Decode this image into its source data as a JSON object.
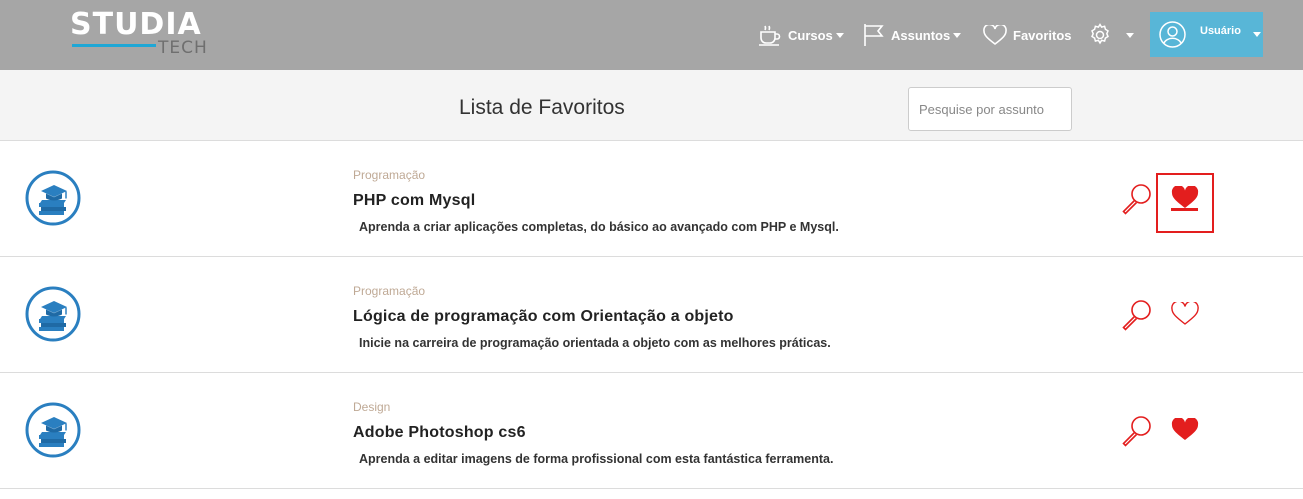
{
  "brand": {
    "main": "STUDIA",
    "sub": "TECH",
    "accent_color": "#1ea7d6"
  },
  "nav": {
    "cursos": {
      "label": "Cursos",
      "icon": "coffee-cup-icon"
    },
    "assuntos": {
      "label": "Assuntos",
      "icon": "flag-icon"
    },
    "favoritos": {
      "label": "Favoritos",
      "icon": "heart-outline-icon"
    },
    "settings": {
      "icon": "gear-icon"
    },
    "user": {
      "label": "Usuário",
      "icon": "user-avatar-icon",
      "bg_color": "#58b6d7"
    }
  },
  "header": {
    "title": "Lista de Favoritos",
    "search_placeholder": "Pesquise por assunto"
  },
  "courses": [
    {
      "category": "Programação",
      "title": "PHP com Mysql",
      "description": "Aprenda a criar aplicações completas, do básico ao avançado com PHP e Mysql.",
      "icon": "graduation-books-icon",
      "favorited": true,
      "highlighted": true
    },
    {
      "category": "Programação",
      "title": "Lógica de programação com Orientação a objeto",
      "description": "Inicie na carreira de programação orientada a objeto com as melhores práticas.",
      "icon": "graduation-books-icon",
      "favorited": false,
      "highlighted": false
    },
    {
      "category": "Design",
      "title": "Adobe Photoshop cs6",
      "description": "Aprenda a editar imagens de forma profissional com esta fantástica ferramenta.",
      "icon": "graduation-books-icon",
      "favorited": true,
      "highlighted": false
    }
  ],
  "colors": {
    "navbar_bg": "#a6a6a6",
    "category_text": "#bfa995",
    "action_red": "#e31e1e",
    "course_icon_blue": "#2a7fc0"
  }
}
